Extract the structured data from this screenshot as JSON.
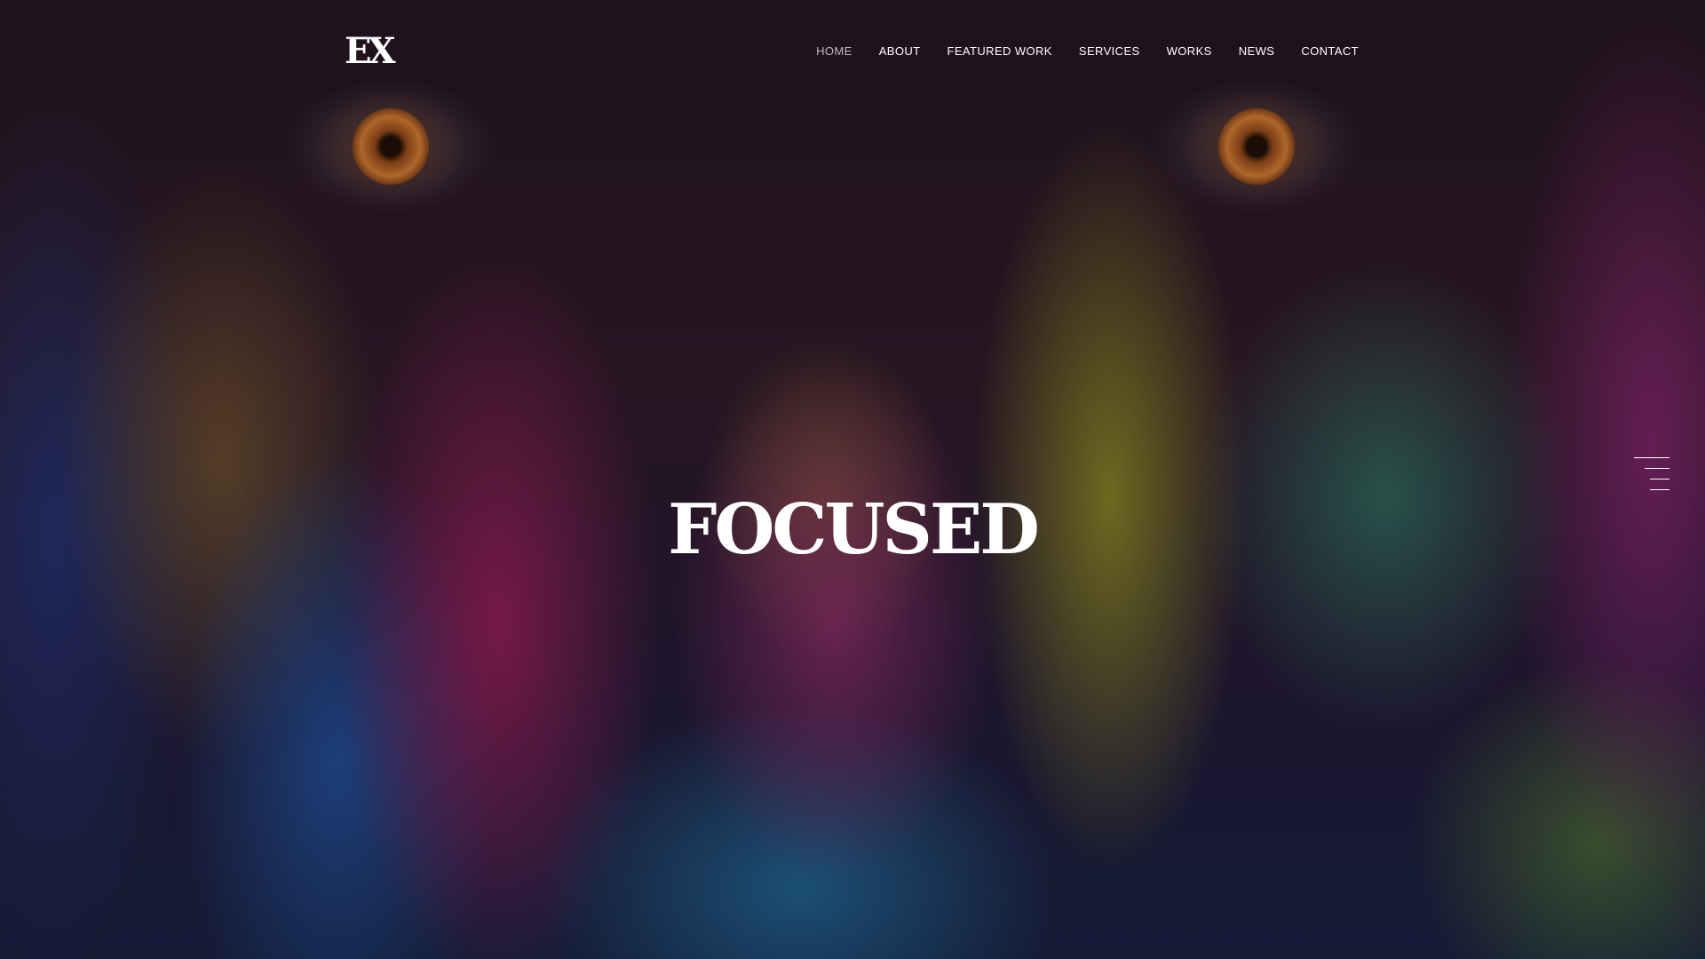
{
  "header": {
    "logo_text": "EX",
    "nav": [
      {
        "label": "HOME",
        "active": true
      },
      {
        "label": "ABOUT"
      },
      {
        "label": "FEATURED WORK"
      },
      {
        "label": "SERVICES"
      },
      {
        "label": "WORKS"
      },
      {
        "label": "NEWS"
      },
      {
        "label": "CONTACT"
      }
    ]
  },
  "hero": {
    "headline": "FOCUSED",
    "background_description_icon": "painted-face-image"
  },
  "menu_toggle": {
    "icon": "hamburger-menu-icon"
  },
  "colors": {
    "text": "#ffffff",
    "nav_active": "#bdb8c0"
  }
}
